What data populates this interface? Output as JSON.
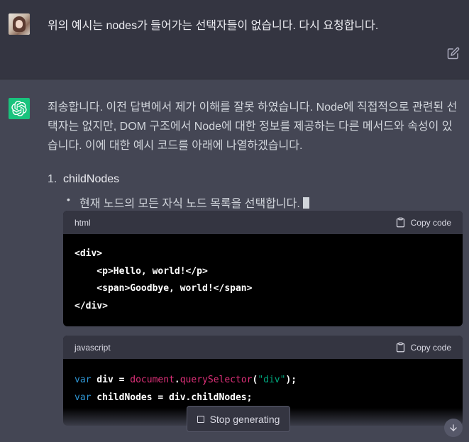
{
  "user": {
    "avatar_icon": "user-avatar-photo",
    "message": "위의 예시는 nodes가 들어가는 선택자들이 없습니다. 다시 요청합니다.",
    "edit_icon": "pencil-square-icon"
  },
  "assistant": {
    "avatar_icon": "openai-logo-icon",
    "avatar_color": "#19c37d",
    "intro": "죄송합니다. 이전 답변에서 제가 이해를 잘못 하였습니다. Node에 직접적으로 관련된 선택자는 없지만, DOM 구조에서 Node에 대한 정보를 제공하는 다른 메서드와 속성이 있습니다. 이에 대한 예시 코드를 아래에 나열하겠습니다.",
    "list": [
      {
        "number": "1.",
        "title": "childNodes",
        "bullet": "현재 노드의 모든 자식 노드 목록을 선택합니다."
      }
    ]
  },
  "code_blocks": [
    {
      "language": "html",
      "copy_label": "Copy code",
      "lines": [
        "<div>",
        "    <p>Hello, world!</p>",
        "    <span>Goodbye, world!</span>",
        "</div>"
      ]
    },
    {
      "language": "javascript",
      "copy_label": "Copy code",
      "line1": {
        "kw": "var",
        "ident": " div = ",
        "obj": "document",
        "dot": ".",
        "method": "querySelector",
        "open": "(",
        "str": "\"div\"",
        "close": ");"
      },
      "line2": {
        "kw": "var",
        "rest": " childNodes = div.childNodes;"
      }
    }
  ],
  "controls": {
    "stop_label": "Stop generating",
    "scroll_icon": "arrow-down-icon"
  },
  "colors": {
    "user_bg": "#343541",
    "assistant_bg": "#444654",
    "code_bg": "#000000",
    "keyword": "#2e95d3",
    "object": "#df3079",
    "string": "#00a67d"
  }
}
